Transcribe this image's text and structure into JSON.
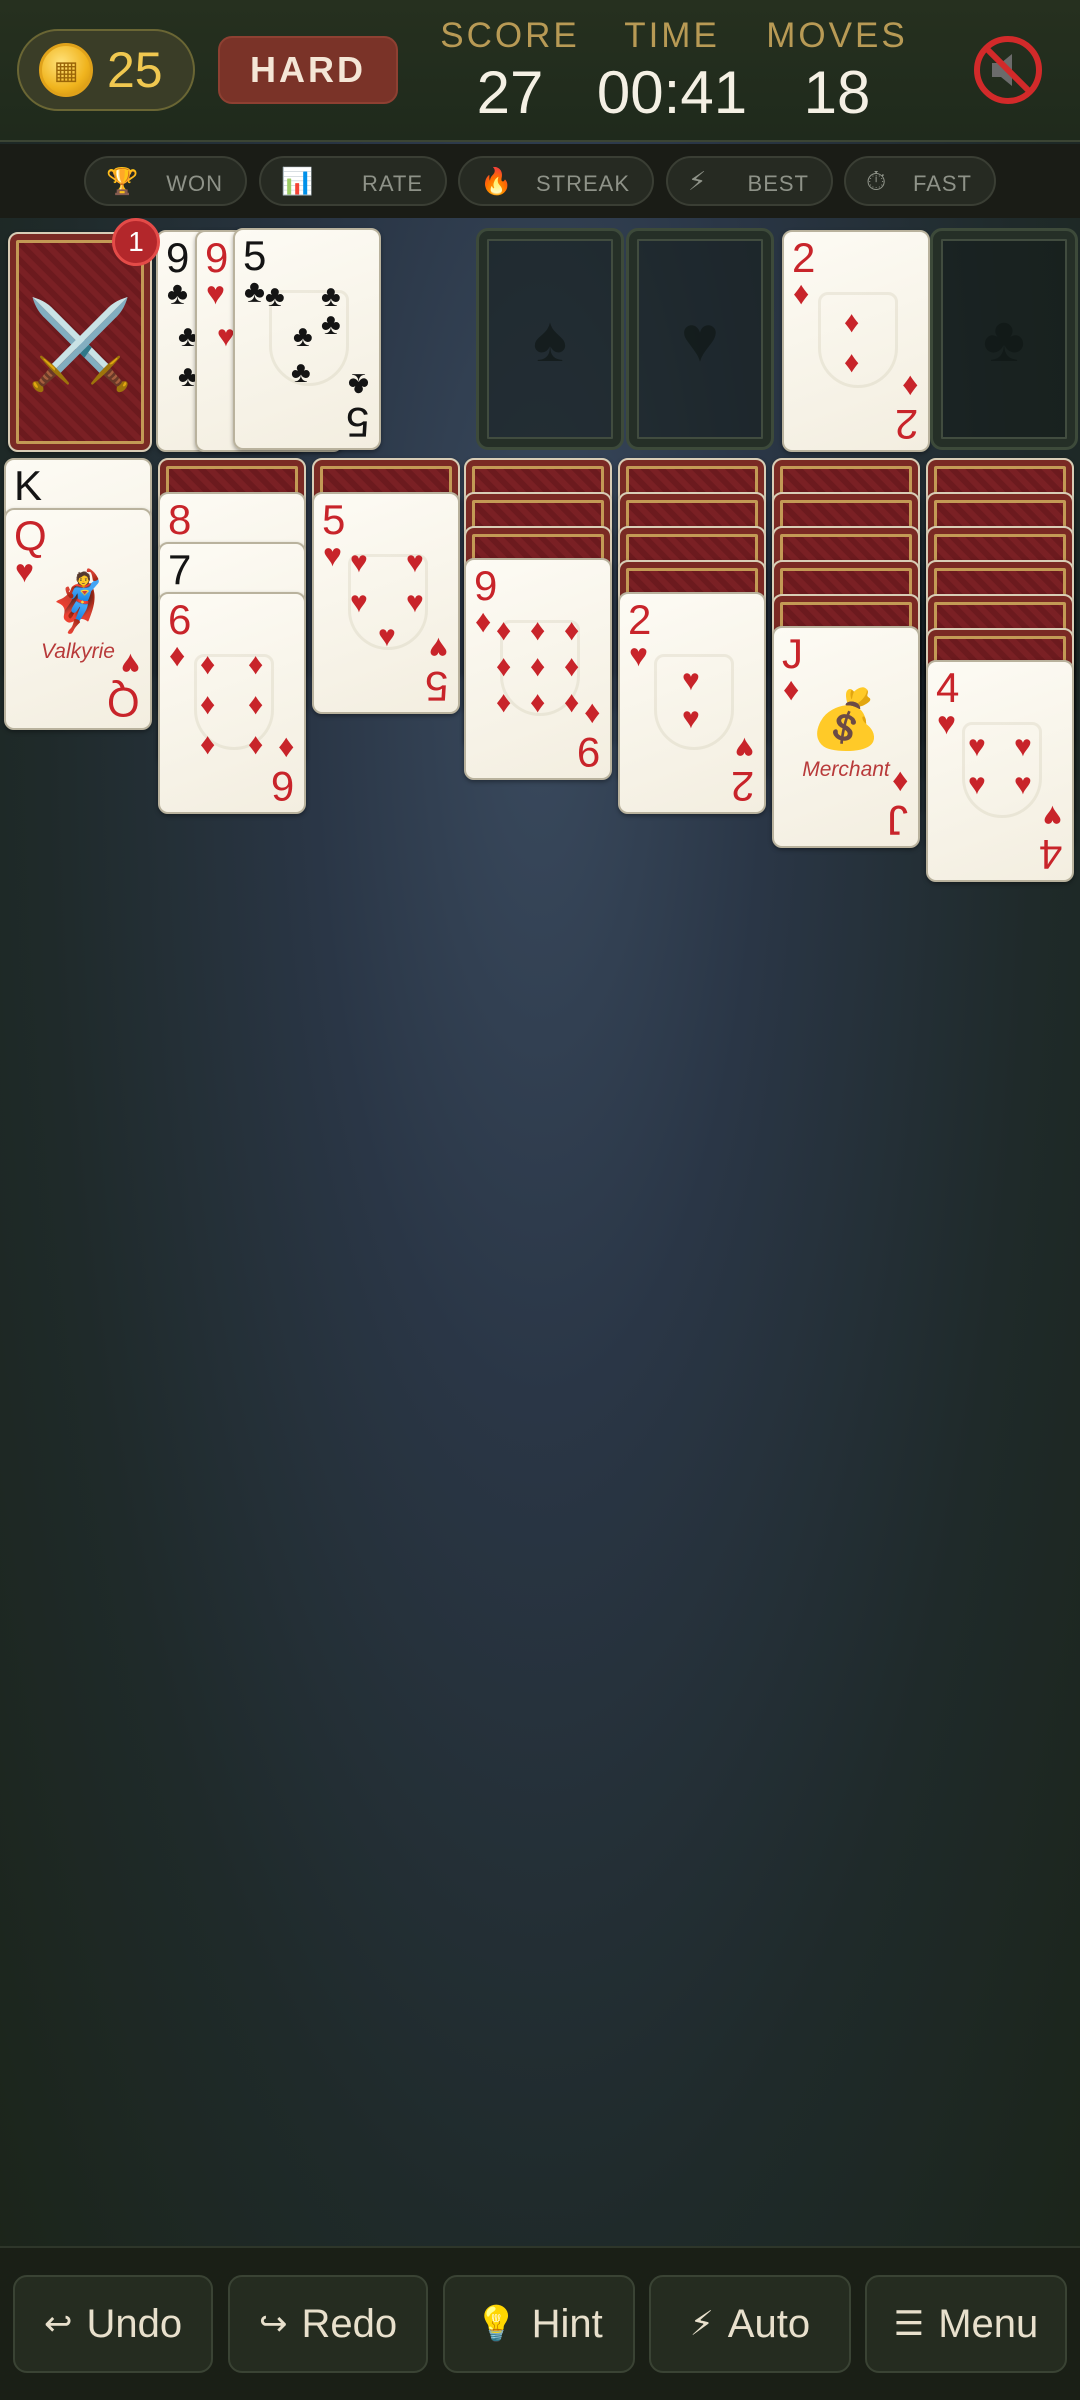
{
  "header": {
    "coins": "25",
    "difficulty": "HARD",
    "score_label": "SCORE",
    "score": "27",
    "time_label": "TIME",
    "time": "00:41",
    "moves_label": "MOVES",
    "moves": "18",
    "sound_icon": "muted-speaker-icon"
  },
  "stats": [
    {
      "icon": "🏆",
      "label": "WON"
    },
    {
      "icon": "📊",
      "label": "RATE"
    },
    {
      "icon": "🔥",
      "label": "STREAK"
    },
    {
      "icon": "⚡",
      "label": "BEST"
    },
    {
      "icon": "⏱",
      "label": "FAST"
    }
  ],
  "stock": {
    "badge": "1",
    "icon": "⚔️"
  },
  "waste": [
    {
      "rank": "9",
      "suit": "♣",
      "color": "black"
    },
    {
      "rank": "9",
      "suit": "♥",
      "color": "red"
    },
    {
      "rank": "5",
      "suit": "♣",
      "color": "black"
    }
  ],
  "foundations": [
    {
      "empty_suit": "♠"
    },
    {
      "empty_suit": "♥"
    },
    {
      "rank": "2",
      "suit": "♦",
      "color": "red"
    },
    {
      "empty_suit": "♣"
    }
  ],
  "tableau": {
    "col1": {
      "k_rank": "K",
      "queen": {
        "rank": "Q",
        "suit": "♥",
        "name": "Valkyrie",
        "emoji": "🦸"
      }
    },
    "col2": {
      "eight": "8",
      "seven": "7",
      "six": {
        "rank": "6",
        "suit": "♦"
      }
    },
    "col3": {
      "five": {
        "rank": "5",
        "suit": "♥"
      }
    },
    "col4": {
      "nine": {
        "rank": "9",
        "suit": "♦"
      }
    },
    "col5": {
      "two": {
        "rank": "2",
        "suit": "♥"
      }
    },
    "col6": {
      "jack": {
        "rank": "J",
        "suit": "♦",
        "name": "Merchant",
        "emoji": "💰"
      }
    },
    "col7": {
      "four": {
        "rank": "4",
        "suit": "♥"
      }
    }
  },
  "buttons": [
    {
      "icon": "↩",
      "label": "Undo"
    },
    {
      "icon": "↪",
      "label": "Redo"
    },
    {
      "icon": "💡",
      "label": "Hint"
    },
    {
      "icon": "⚡",
      "label": "Auto"
    },
    {
      "icon": "☰",
      "label": "Menu"
    }
  ]
}
